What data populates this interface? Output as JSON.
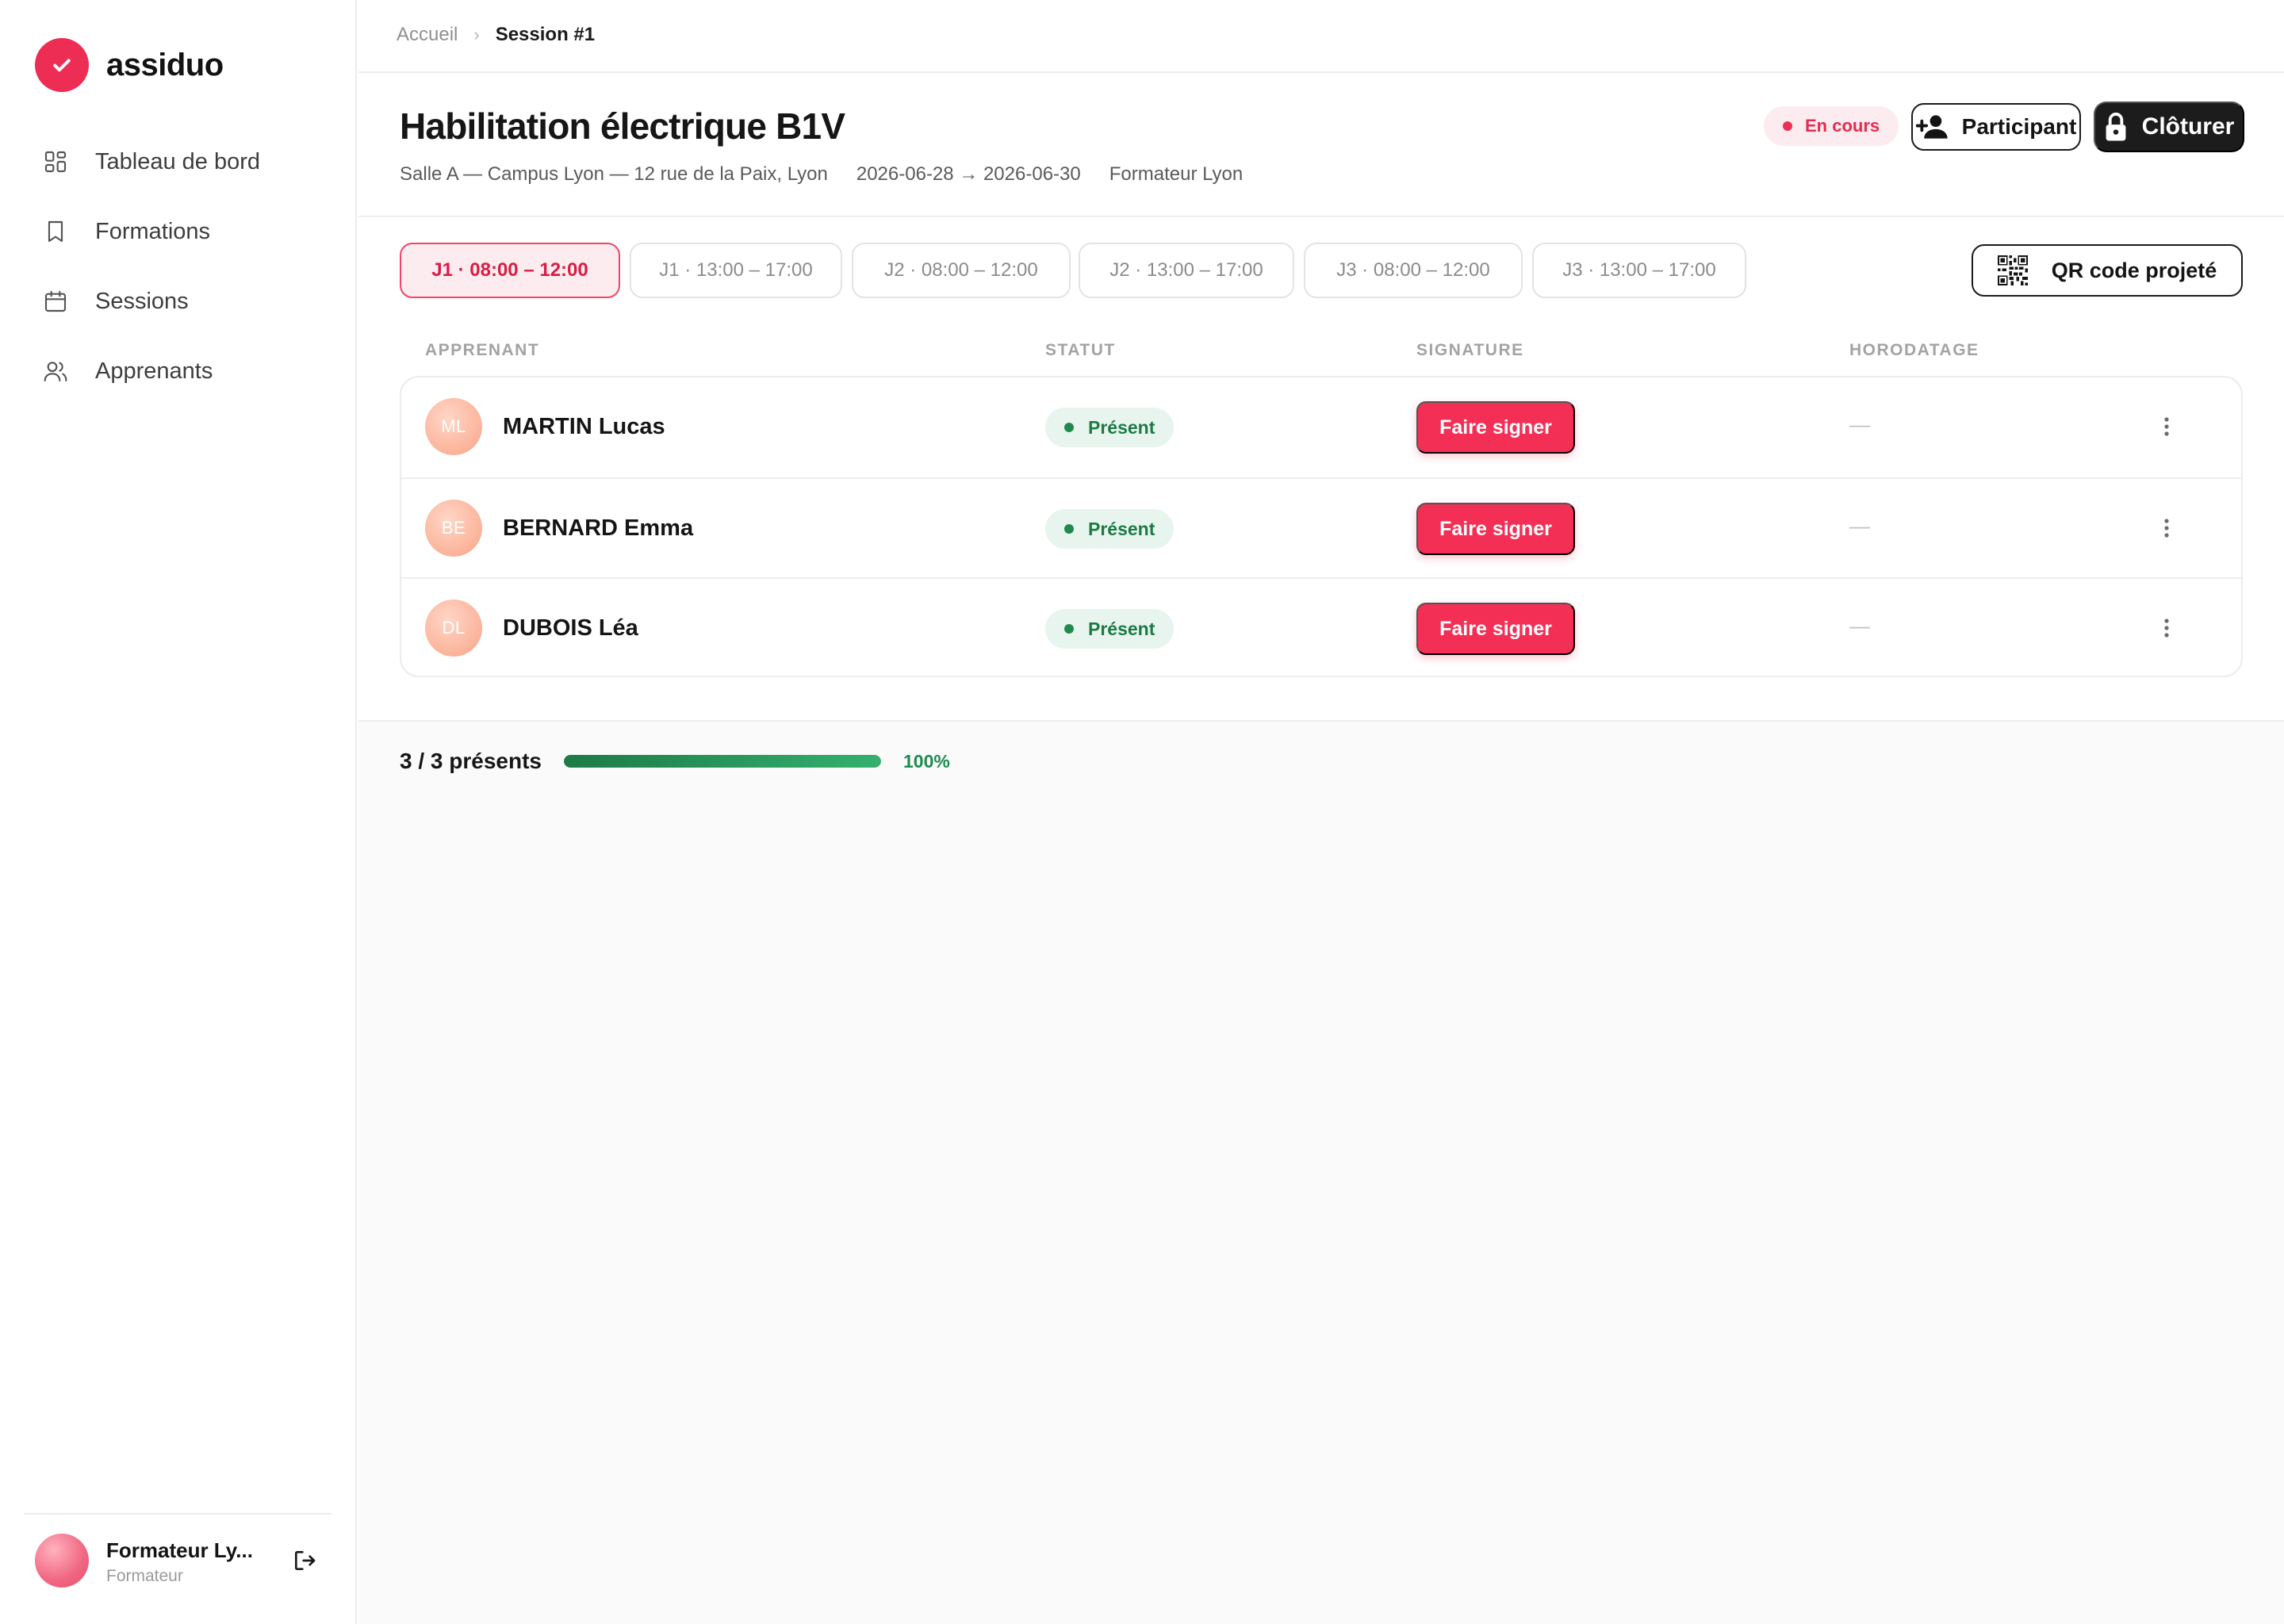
{
  "app": {
    "name": "assiduo"
  },
  "sidebar": {
    "items": [
      {
        "label": "Tableau de bord",
        "icon": "dashboard-icon"
      },
      {
        "label": "Formations",
        "icon": "bookmark-icon"
      },
      {
        "label": "Sessions",
        "icon": "calendar-icon"
      },
      {
        "label": "Apprenants",
        "icon": "users-icon"
      }
    ],
    "user": {
      "name": "Formateur Ly...",
      "role": "Formateur"
    }
  },
  "breadcrumb": {
    "home": "Accueil",
    "current": "Session #1"
  },
  "session": {
    "title": "Habilitation électrique B1V",
    "location": "Salle A — Campus Lyon — 12 rue de la Paix, Lyon",
    "dates": "2026-06-28 → 2026-06-30",
    "trainer": "Formateur Lyon",
    "status": "En cours"
  },
  "actions": {
    "participant": "Participant",
    "cloturer": "Clôturer",
    "qr": "QR code projeté"
  },
  "slots": [
    {
      "label": "J1 · 08:00 – 12:00",
      "active": true
    },
    {
      "label": "J1 · 13:00 – 17:00",
      "active": false
    },
    {
      "label": "J2 · 08:00 – 12:00",
      "active": false
    },
    {
      "label": "J2 · 13:00 – 17:00",
      "active": false
    },
    {
      "label": "J3 · 08:00 – 12:00",
      "active": false
    },
    {
      "label": "J3 · 13:00 – 17:00",
      "active": false
    }
  ],
  "table": {
    "headers": {
      "learner": "APPRENANT",
      "status": "STATUT",
      "signature": "SIGNATURE",
      "timestamp": "HORODATAGE"
    },
    "rows": [
      {
        "initials": "ML",
        "name": "MARTIN Lucas",
        "status": "Présent",
        "action": "Faire signer",
        "timestamp": "—"
      },
      {
        "initials": "BE",
        "name": "BERNARD Emma",
        "status": "Présent",
        "action": "Faire signer",
        "timestamp": "—"
      },
      {
        "initials": "DL",
        "name": "DUBOIS Léa",
        "status": "Présent",
        "action": "Faire signer",
        "timestamp": "—"
      }
    ]
  },
  "summary": {
    "count": "3 / 3 présents",
    "percent": "100%",
    "fill": 1.0
  },
  "colors": {
    "brand": "#ee2d55",
    "success": "#1f8a4e",
    "dark": "#1c1c1c"
  }
}
